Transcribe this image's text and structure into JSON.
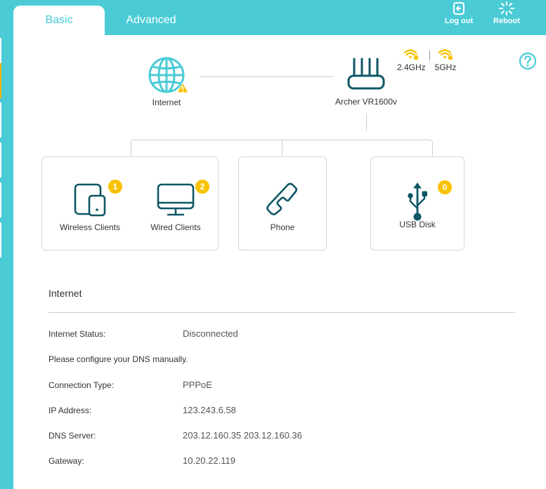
{
  "tabs": [
    {
      "label": "Basic",
      "active": true
    },
    {
      "label": "Advanced",
      "active": false
    }
  ],
  "top_actions": {
    "logout": {
      "label": "Log out",
      "icon": "logout-icon"
    },
    "reboot": {
      "label": "Reboot",
      "icon": "reboot-icon"
    }
  },
  "sidebar": {
    "active_index": 1,
    "item_count": 6
  },
  "topology": {
    "internet": {
      "label": "Internet",
      "icon": "globe-icon",
      "warning": true
    },
    "router": {
      "label": "Archer VR1600v",
      "icon": "router-icon"
    },
    "wifi_bands": [
      {
        "label": "2.4GHz",
        "icon": "wifi-locked-icon"
      },
      {
        "label": "5GHz",
        "icon": "wifi-locked-icon"
      }
    ],
    "clients": [
      {
        "label": "Wireless Clients",
        "count": "1",
        "icon": "wireless-device-icon"
      },
      {
        "label": "Wired Clients",
        "count": "2",
        "icon": "monitor-icon"
      },
      {
        "label": "Phone",
        "icon": "phone-icon"
      },
      {
        "label": "USB Disk",
        "count": "0",
        "icon": "usb-icon"
      }
    ]
  },
  "internet_section": {
    "title": "Internet",
    "rows": [
      {
        "key": "Internet Status:",
        "value": "Disconnected"
      },
      {
        "key": "Please configure your DNS manually.",
        "value": ""
      },
      {
        "key": "Connection Type:",
        "value": "PPPoE"
      },
      {
        "key": "IP Address:",
        "value": "123.243.6.58"
      },
      {
        "key": "DNS Server:",
        "value": "203.12.160.35 203.12.160.36"
      },
      {
        "key": "Gateway:",
        "value": "10.20.22.119"
      }
    ]
  },
  "colors": {
    "brand": "#4acbd6",
    "icon": "#0f5766",
    "badge": "#f7c200",
    "active_indicator": "#f2b600"
  }
}
